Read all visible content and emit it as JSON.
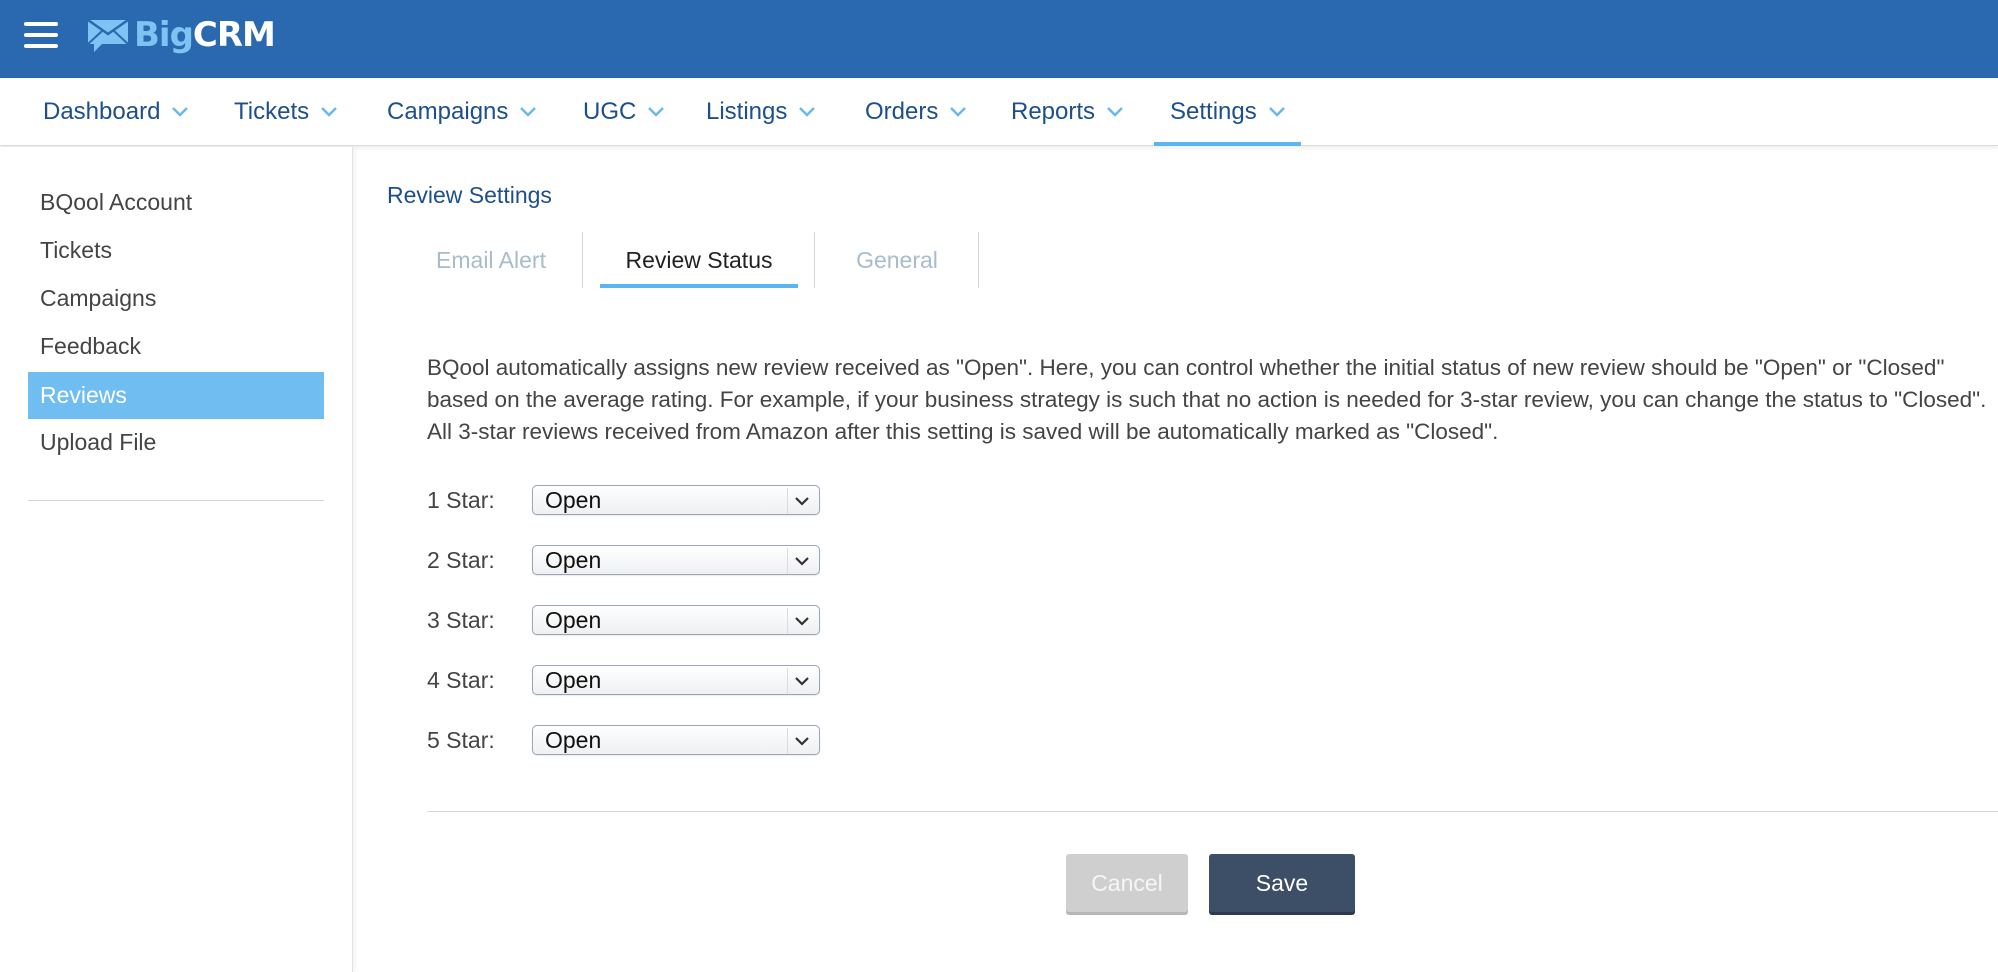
{
  "app": {
    "logo_big": "Big",
    "logo_crm": "CRM"
  },
  "nav": {
    "items": [
      {
        "label": "Dashboard"
      },
      {
        "label": "Tickets"
      },
      {
        "label": "Campaigns"
      },
      {
        "label": "UGC"
      },
      {
        "label": "Listings"
      },
      {
        "label": "Orders"
      },
      {
        "label": "Reports"
      },
      {
        "label": "Settings"
      }
    ],
    "active": "Settings"
  },
  "sidebar": {
    "items": [
      {
        "label": "BQool Account"
      },
      {
        "label": "Tickets"
      },
      {
        "label": "Campaigns"
      },
      {
        "label": "Feedback"
      },
      {
        "label": "Reviews"
      },
      {
        "label": "Upload File"
      }
    ],
    "active": "Reviews"
  },
  "main": {
    "section_title": "Review Settings",
    "tabs": [
      {
        "label": "Email Alert"
      },
      {
        "label": "Review Status"
      },
      {
        "label": "General"
      }
    ],
    "active_tab": "Review Status",
    "description": "BQool automatically assigns new review received as \"Open\". Here, you can control whether the initial status of new review should be \"Open\" or \"Closed\" based on the average rating. For example, if your business strategy is such that no action is needed for 3-star review, you can change the status to \"Closed\". All 3-star reviews received from Amazon after this setting is saved will be automatically marked as \"Closed\".",
    "star_settings": [
      {
        "label": "1 Star:",
        "value": "Open"
      },
      {
        "label": "2 Star:",
        "value": "Open"
      },
      {
        "label": "3 Star:",
        "value": "Open"
      },
      {
        "label": "4 Star:",
        "value": "Open"
      },
      {
        "label": "5 Star:",
        "value": "Open"
      }
    ],
    "cancel_label": "Cancel",
    "save_label": "Save"
  },
  "colors": {
    "topbar": "#2a68b0",
    "accent": "#5bb5ee",
    "sidebar_active": "#70bdf2",
    "save_button": "#3d4f66"
  }
}
